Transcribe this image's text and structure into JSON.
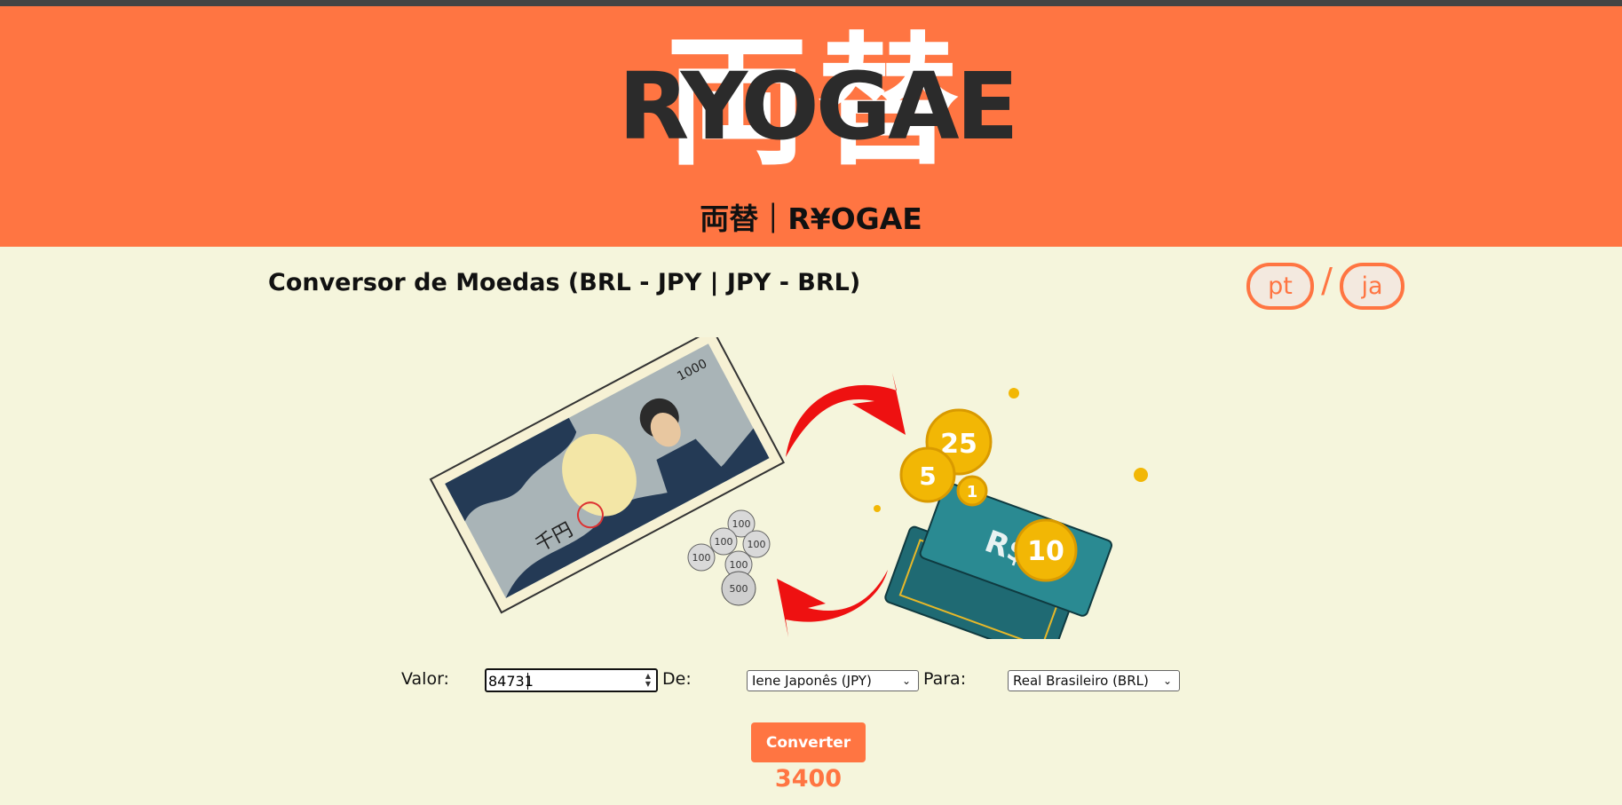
{
  "header": {
    "logo_kanji": "両替",
    "logo_latin": "RYOGAE",
    "site_title": "両替｜R¥OGAE",
    "background_color": "#ff7542"
  },
  "main": {
    "heading": "Conversor de Moedas (BRL - JPY | JPY - BRL)",
    "language_switch": {
      "pt_label": "pt",
      "separator": "/",
      "ja_label": "ja"
    },
    "illustration": {
      "left_note_text": "1000",
      "left_note_yen": "千円",
      "coin_labels": [
        "100",
        "100",
        "100",
        "100",
        "100",
        "500"
      ],
      "right_note_text": "R$",
      "right_coin_labels": [
        "25",
        "5",
        "1",
        "10"
      ]
    },
    "form": {
      "value_label": "Valor:",
      "value_input": "84731",
      "from_label": "De:",
      "from_selected": "Iene Japonês (JPY)",
      "to_label": "Para:",
      "to_selected": "Real Brasileiro (BRL)",
      "convert_button": "Converter",
      "result": "3400"
    },
    "accent_color": "#ff7542",
    "background_color": "#f5f5dc"
  }
}
